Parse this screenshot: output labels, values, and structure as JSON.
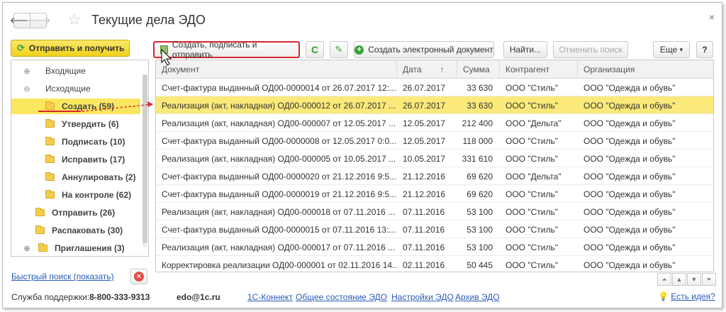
{
  "window": {
    "title": "Текущие дела ЭДО",
    "close_glyph": "×",
    "back_glyph": "🡐",
    "fwd_glyph": "🡒"
  },
  "left": {
    "send_button": "Отправить и получить",
    "tree": [
      {
        "label": "Входящие",
        "toggle": "⊕",
        "level": 0,
        "folder": false
      },
      {
        "label": "Исходящие",
        "toggle": "⊖",
        "level": 0,
        "folder": false
      },
      {
        "label": "Создать (59)",
        "level": 1,
        "folder": true,
        "bold": true,
        "selected": true
      },
      {
        "label": "Утвердить (6)",
        "level": 1,
        "folder": true,
        "bold": true
      },
      {
        "label": "Подписать (10)",
        "level": 1,
        "folder": true,
        "bold": true
      },
      {
        "label": "Исправить (17)",
        "level": 1,
        "folder": true,
        "bold": true
      },
      {
        "label": "Аннулировать (2)",
        "level": 1,
        "folder": true,
        "bold": true
      },
      {
        "label": "На контроле (62)",
        "level": 1,
        "folder": true,
        "bold": true
      },
      {
        "label": "Отправить (26)",
        "level": 0,
        "folder": true,
        "bold": true
      },
      {
        "label": "Распаковать (30)",
        "level": 0,
        "folder": true,
        "bold": true
      },
      {
        "label": "Приглашения (3)",
        "toggle": "⊕",
        "level": 0,
        "folder": true,
        "bold": true
      }
    ],
    "quick_search": "Быстрый поиск (показать)"
  },
  "toolbar": {
    "create_sign_send": "Создать, подписать и отправить",
    "create_edoc": "Создать электронный документ",
    "find": "Найти...",
    "cancel_search": "Отменить поиск",
    "more": "Еще",
    "more_arrow": "▾",
    "help": "?",
    "refresh_glyph": "C",
    "edit_glyph": "✎"
  },
  "table": {
    "columns": [
      "Документ",
      "Дата",
      "Сумма",
      "Контрагент",
      "Организация"
    ],
    "sort_arrow": "↑",
    "rows": [
      {
        "doc": "Счет-фактура выданный ОД00-0000014 от 26.07.2017 12:...",
        "date": "26.07.2017",
        "sum": "33 630",
        "contr": "ООО \"Стиль\"",
        "org": "ООО \"Одежда и обувь\""
      },
      {
        "doc": "Реализация (акт, накладная) ОД00-000012 от 26.07.2017 ...",
        "date": "26.07.2017",
        "sum": "33 630",
        "contr": "ООО \"Стиль\"",
        "org": "ООО \"Одежда и обувь\"",
        "selected": true
      },
      {
        "doc": "Реализация (акт, накладная) ОД00-000007 от 12.05.2017 ...",
        "date": "12.05.2017",
        "sum": "212 400",
        "contr": "ООО \"Дельта\"",
        "org": "ООО \"Одежда и обувь\""
      },
      {
        "doc": "Счет-фактура выданный ОД00-0000008 от 12.05.2017 0:0...",
        "date": "12.05.2017",
        "sum": "118 000",
        "contr": "ООО \"Стиль\"",
        "org": "ООО \"Одежда и обувь\""
      },
      {
        "doc": "Реализация (акт, накладная) ОД00-000005 от 10.05.2017 ...",
        "date": "10.05.2017",
        "sum": "331 610",
        "contr": "ООО \"Стиль\"",
        "org": "ООО \"Одежда и обувь\""
      },
      {
        "doc": "Счет-фактура выданный ОД00-0000020 от 21.12.2016 9:5...",
        "date": "21.12.2016",
        "sum": "69 620",
        "contr": "ООО \"Дельта\"",
        "org": "ООО \"Одежда и обувь\""
      },
      {
        "doc": "Счет-фактура выданный ОД00-0000019 от 21.12.2016 9:5...",
        "date": "21.12.2016",
        "sum": "69 620",
        "contr": "ООО \"Стиль\"",
        "org": "ООО \"Одежда и обувь\""
      },
      {
        "doc": "Реализация (акт, накладная) ОД00-000018 от 07.11.2016 ...",
        "date": "07.11.2016",
        "sum": "53 100",
        "contr": "ООО \"Стиль\"",
        "org": "ООО \"Одежда и обувь\""
      },
      {
        "doc": "Счет-фактура выданный ОД00-0000015 от 07.11.2016 13:...",
        "date": "07.11.2016",
        "sum": "53 100",
        "contr": "ООО \"Стиль\"",
        "org": "ООО \"Одежда и обувь\""
      },
      {
        "doc": "Реализация (акт, накладная) ОД00-000017 от 07.11.2016 ...",
        "date": "07.11.2016",
        "sum": "53 100",
        "contr": "ООО \"Стиль\"",
        "org": "ООО \"Одежда и обувь\""
      },
      {
        "doc": "Корректировка реализации ОД00-000001 от 02.11.2016 14...",
        "date": "02.11.2016",
        "sum": "50 445",
        "contr": "ООО \"Стиль\"",
        "org": "ООО \"Одежда и обувь\""
      }
    ]
  },
  "pager": {
    "first": "⏶",
    "up": "▲",
    "down": "▼",
    "last": "⏷"
  },
  "footer": {
    "support_label": "Служба поддержки:",
    "support_phone": "8-800-333-9313",
    "email": "edo@1c.ru",
    "connect": "1С-Коннект",
    "status": "Общее состояние ЭДО",
    "settings": "Настройки ЭДО",
    "archive": "Архив ЭДО",
    "idea": "Есть идея?"
  },
  "colors": {
    "accent_yellow": "#fbe65f",
    "selection": "#fbe97a",
    "annotation_red": "#d9262d",
    "link_blue": "#2a5bb8"
  }
}
